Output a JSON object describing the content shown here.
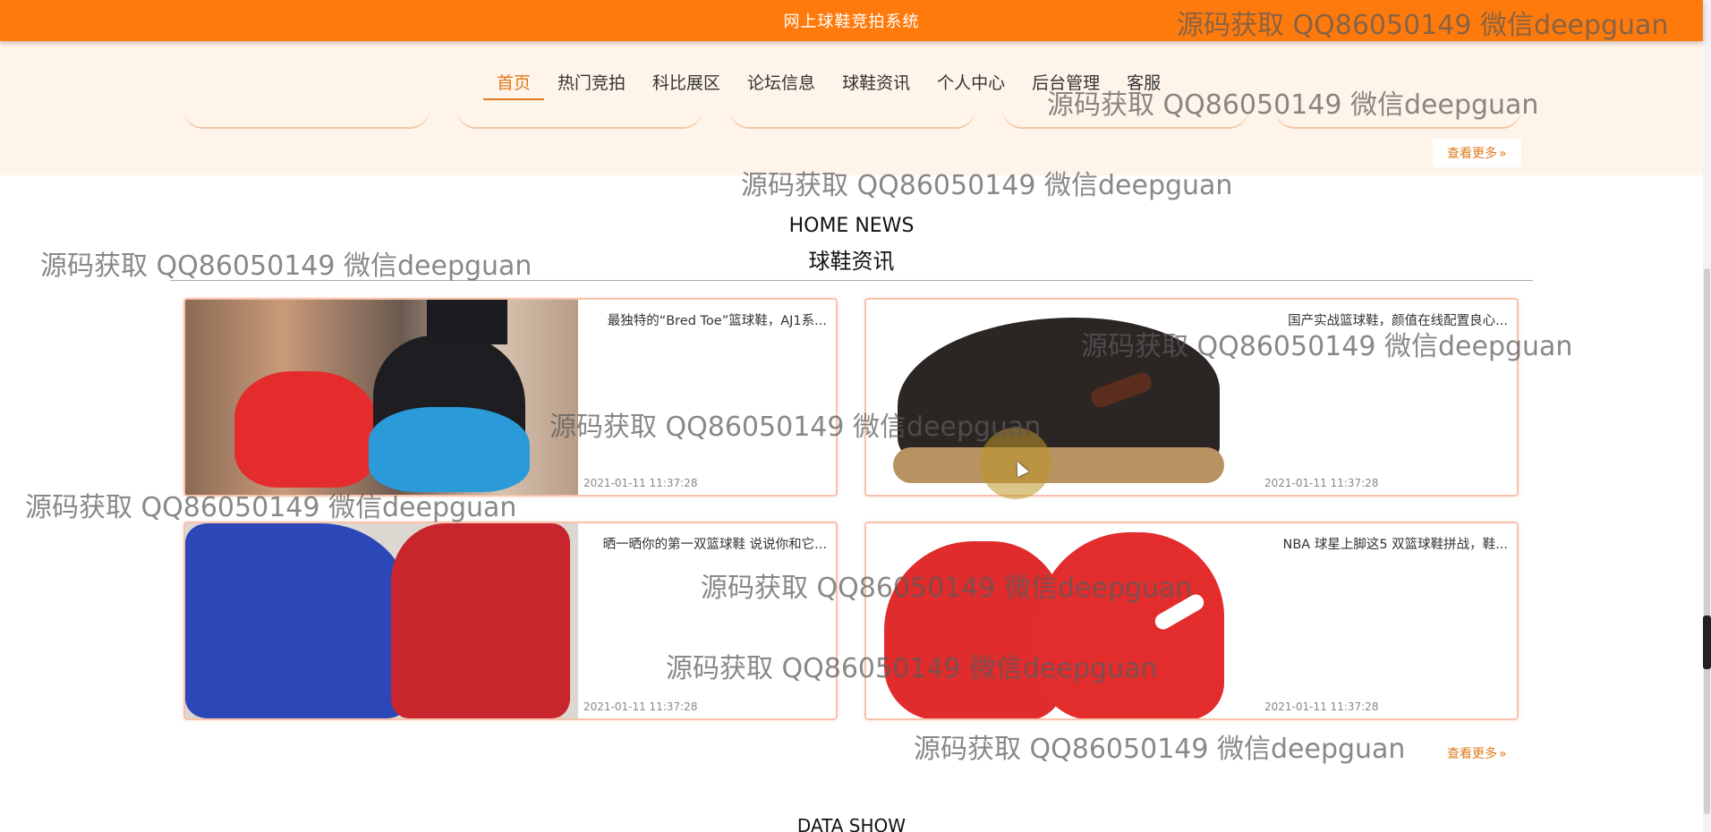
{
  "header": {
    "title": "网上球鞋竞拍系统"
  },
  "nav": {
    "items": [
      {
        "label": "首页"
      },
      {
        "label": "热门竞拍"
      },
      {
        "label": "科比展区"
      },
      {
        "label": "论坛信息"
      },
      {
        "label": "球鞋资讯"
      },
      {
        "label": "个人中心"
      },
      {
        "label": "后台管理"
      },
      {
        "label": "客服"
      }
    ],
    "active_index": 0
  },
  "previous_section": {
    "more_label": "查看更多"
  },
  "news": {
    "heading_en": "HOME NEWS",
    "heading_zh": "球鞋资讯",
    "more_label": "查看更多",
    "items": [
      {
        "title": "最独特的“Bred Toe”篮球鞋，AJ1系...",
        "time": "2021-01-11 11:37:28",
        "image": "red-blue-basketball-shoes-photo"
      },
      {
        "title": "国产实战篮球鞋，颜值在线配置良心...",
        "time": "2021-01-11 11:37:28",
        "image": "black-high-top-shoe-photo"
      },
      {
        "title": "晒一晒你的第一双篮球鞋 说说你和它...",
        "time": "2021-01-11 11:37:28",
        "image": "blue-red-adidas-shoes-photo"
      },
      {
        "title": "NBA 球星上脚这5 双篮球鞋拼战，鞋...",
        "time": "2021-01-11 11:37:28",
        "image": "red-knit-nike-shoes-photo"
      }
    ]
  },
  "data_show": {
    "heading_en": "DATA SHOW"
  },
  "watermark": {
    "text": "源码获取 QQ86050149 微信deepguan"
  },
  "colors": {
    "accent": "#ff7a0c",
    "active_nav": "#e07a1c",
    "card_border": "#f6c2ab",
    "band_bg": "#fff4ea"
  },
  "icons": {
    "more": "double-chevron-right-icon"
  }
}
